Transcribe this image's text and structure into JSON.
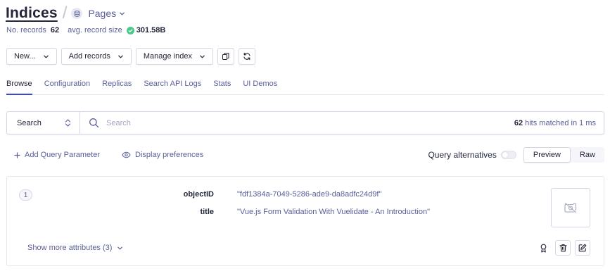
{
  "header": {
    "title": "Indices",
    "index_name": "Pages",
    "icons": {
      "index": "database-icon",
      "dropdown": "chevron-down-icon"
    }
  },
  "meta": {
    "records_label": "No. records",
    "records_value": "62",
    "avg_size_label": "avg. record size",
    "avg_size_value": "301.58B",
    "status_color": "#4bc98a"
  },
  "toolbar": {
    "new_label": "New...",
    "add_records_label": "Add records",
    "manage_index_label": "Manage index",
    "icons": [
      "copy-icon",
      "refresh-icon"
    ]
  },
  "tabs": [
    {
      "label": "Browse",
      "active": true
    },
    {
      "label": "Configuration",
      "active": false
    },
    {
      "label": "Replicas",
      "active": false
    },
    {
      "label": "Search API Logs",
      "active": false
    },
    {
      "label": "Stats",
      "active": false
    },
    {
      "label": "UI Demos",
      "active": false
    }
  ],
  "search": {
    "mode_label": "Search",
    "placeholder": "Search",
    "value": "",
    "hits_count": "62",
    "hits_text": "hits matched in 1 ms"
  },
  "options": {
    "add_query_param": "Add Query Parameter",
    "display_prefs": "Display preferences",
    "query_alternatives": "Query alternatives",
    "query_alternatives_on": false,
    "view_modes": [
      "Preview",
      "Raw"
    ],
    "active_view": "Preview"
  },
  "record": {
    "number": "1",
    "attributes": [
      {
        "key": "objectID",
        "value": "\"fdf1384a-7049-5286-ade9-da8adfc24d9f\""
      },
      {
        "key": "title",
        "value": "\"Vue.js Form Validation With Vuelidate - An Introduction\""
      }
    ],
    "show_more": "Show more attributes (3)",
    "thumbnail_icon": "no-image-icon",
    "action_icons": [
      "rank-icon",
      "trash-icon",
      "edit-icon"
    ]
  },
  "colors": {
    "accent": "#3a46d6",
    "text": "#23263b",
    "muted": "#5a5e9a",
    "border": "#d6d6e7"
  }
}
